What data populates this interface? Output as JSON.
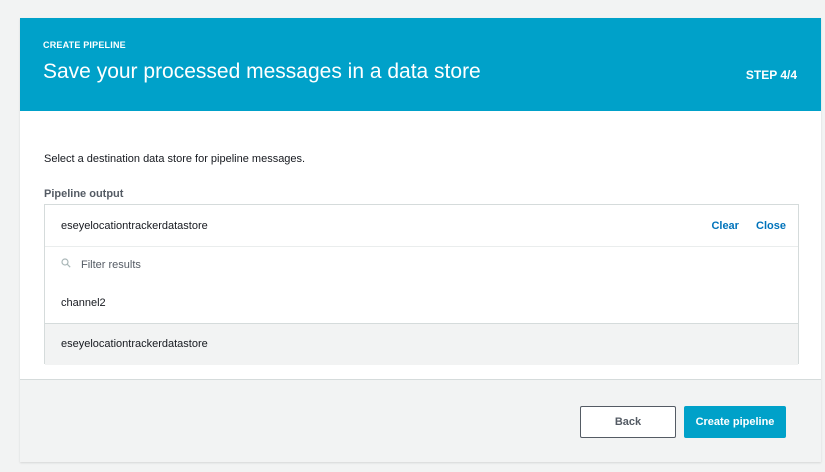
{
  "header": {
    "eyebrow": "CREATE PIPELINE",
    "title": "Save your processed messages in a data store",
    "step": "STEP 4/4"
  },
  "body": {
    "description": "Select a destination data store for pipeline messages.",
    "field_label": "Pipeline output"
  },
  "dropdown": {
    "selected_value": "eseyelocationtrackerdatastore",
    "clear_label": "Clear",
    "close_label": "Close",
    "filter_placeholder": "Filter results",
    "filter_icon": "search-icon",
    "options": [
      {
        "label": "channel2"
      },
      {
        "label": "eseyelocationtrackerdatastore"
      }
    ]
  },
  "footer": {
    "back_label": "Back",
    "create_label": "Create pipeline"
  },
  "colors": {
    "accent": "#00a1c9",
    "link": "#0073bb",
    "background": "#f2f3f3"
  }
}
